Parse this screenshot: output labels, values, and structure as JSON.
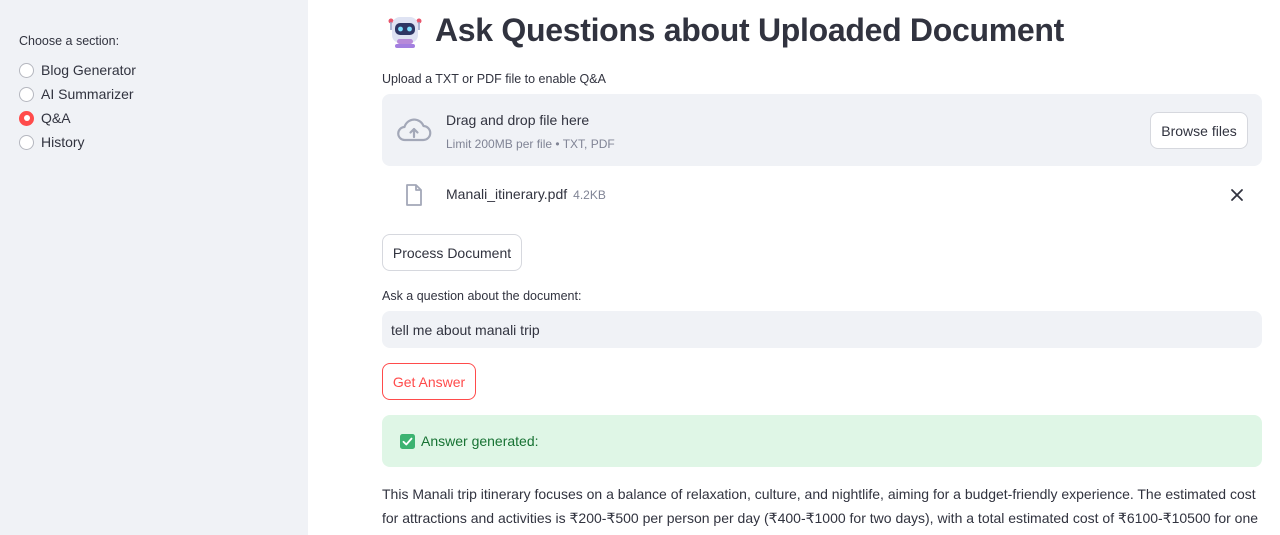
{
  "sidebar": {
    "label": "Choose a section:",
    "options": [
      {
        "label": "Blog Generator",
        "selected": false
      },
      {
        "label": "AI Summarizer",
        "selected": false
      },
      {
        "label": "Q&A",
        "selected": true
      },
      {
        "label": "History",
        "selected": false
      }
    ]
  },
  "main": {
    "title": "Ask Questions about Uploaded Document",
    "title_icon": "robot-emoji",
    "upload": {
      "label": "Upload a TXT or PDF file to enable Q&A",
      "drop_text": "Drag and drop file here",
      "limit_text": "Limit 200MB per file • TXT, PDF",
      "browse_label": "Browse files"
    },
    "file": {
      "name": "Manali_itinerary.pdf",
      "size": "4.2KB"
    },
    "process_label": "Process Document",
    "question": {
      "label": "Ask a question about the document:",
      "value": "tell me about manali trip"
    },
    "get_answer_label": "Get Answer",
    "success_text": "Answer generated:",
    "answer_text": "This Manali trip itinerary focuses on a balance of relaxation, culture, and nightlife, aiming for a budget-friendly experience. The estimated cost for attractions and activities is ₹200-₹500 per person per day (₹400-₹1000 for two days), with a total estimated cost of ₹6100-₹10500 for one"
  },
  "colors": {
    "accent": "#ff4b4b",
    "sidebar_bg": "#f0f2f6",
    "success_bg": "#dff6e6",
    "success_text": "#177233"
  }
}
